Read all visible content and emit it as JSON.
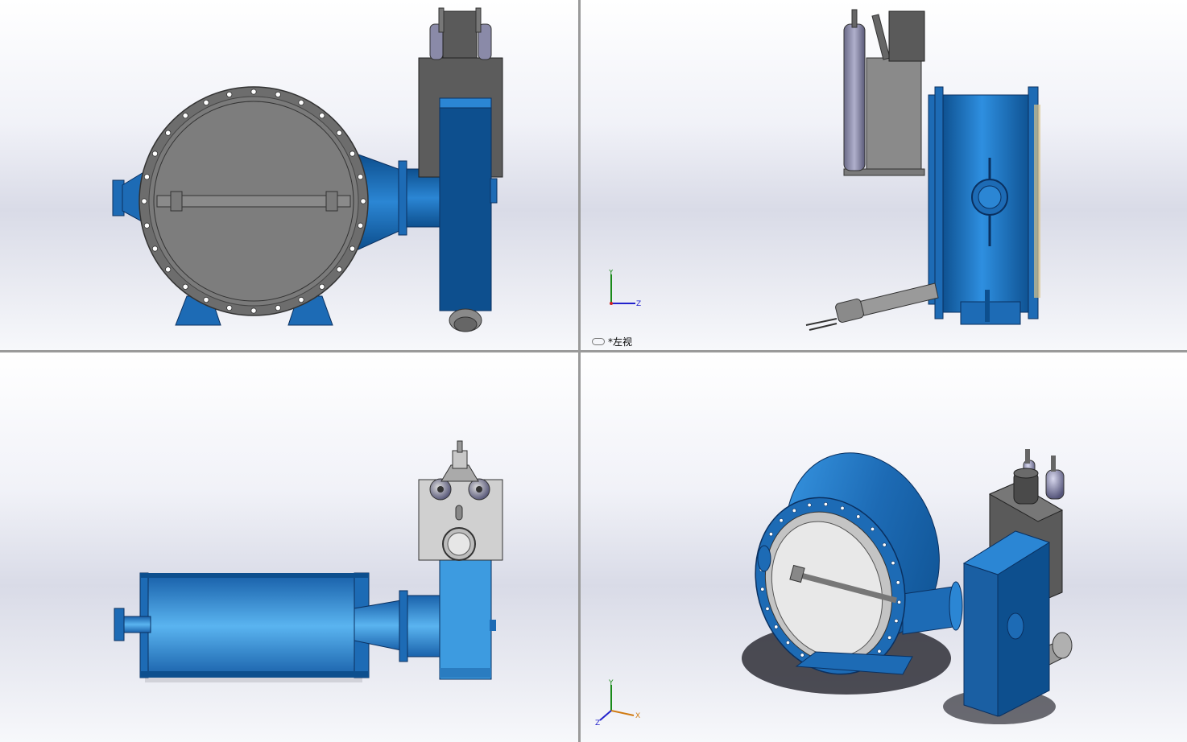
{
  "layout": "four-view",
  "viewports": {
    "front": {
      "name": "front-view"
    },
    "left": {
      "name": "left-view",
      "label": "*左视"
    },
    "top": {
      "name": "top-view"
    },
    "iso": {
      "name": "isometric-view"
    }
  },
  "axes": {
    "x": "X",
    "y": "Y",
    "z": "Z"
  },
  "colors": {
    "body_blue": "#1d6bb5",
    "dark_blue": "#0d4f8e",
    "light_blue": "#3d9be0",
    "steel": "#8a8a8a",
    "dark_gray": "#5a5a5a",
    "cylinder": "#8a8aa8"
  }
}
